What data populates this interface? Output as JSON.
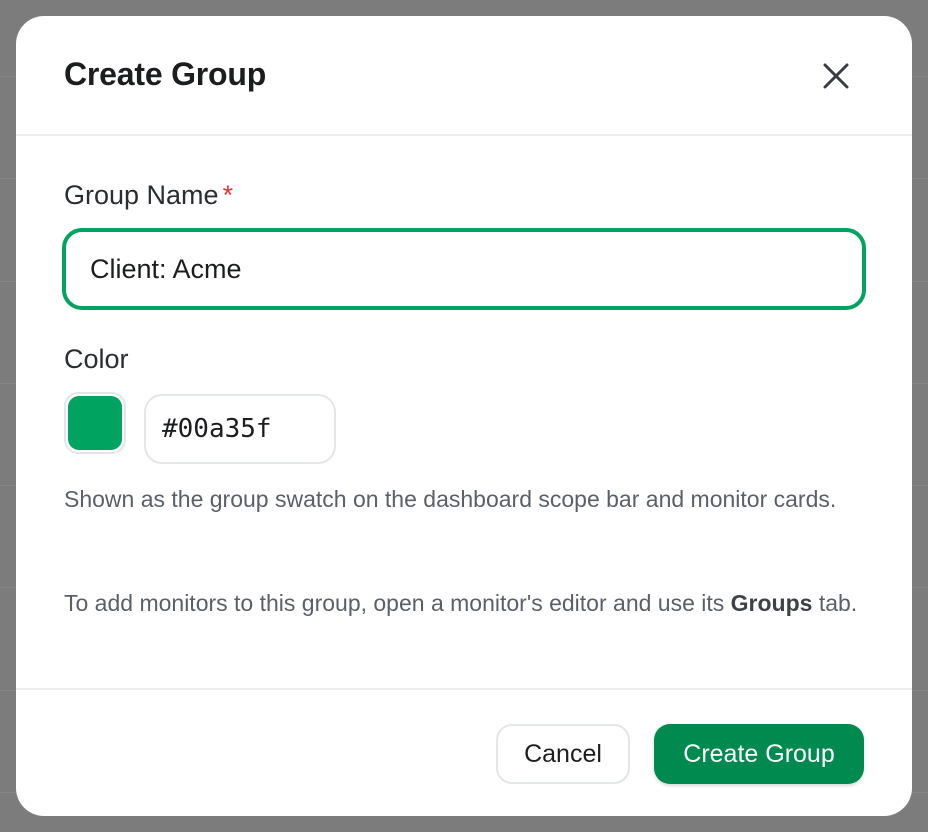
{
  "modal": {
    "title": "Create Group"
  },
  "form": {
    "name_label": "Group Name",
    "required_marker": "*",
    "name_value": "Client: Acme",
    "color_label": "Color",
    "color_value": "#00a35f",
    "help_swatch": "Shown as the group swatch on the dashboard scope bar and monitor cards.",
    "help_add_prefix": "To add monitors to this group, open a monitor's editor and use its ",
    "help_add_bold": "Groups",
    "help_add_suffix": " tab."
  },
  "footer": {
    "cancel_label": "Cancel",
    "create_label": "Create Group"
  },
  "colors": {
    "accent": "#00a35f",
    "primary_button": "#008a50",
    "required": "#e0342f"
  },
  "icons": {
    "close": "close-icon"
  }
}
